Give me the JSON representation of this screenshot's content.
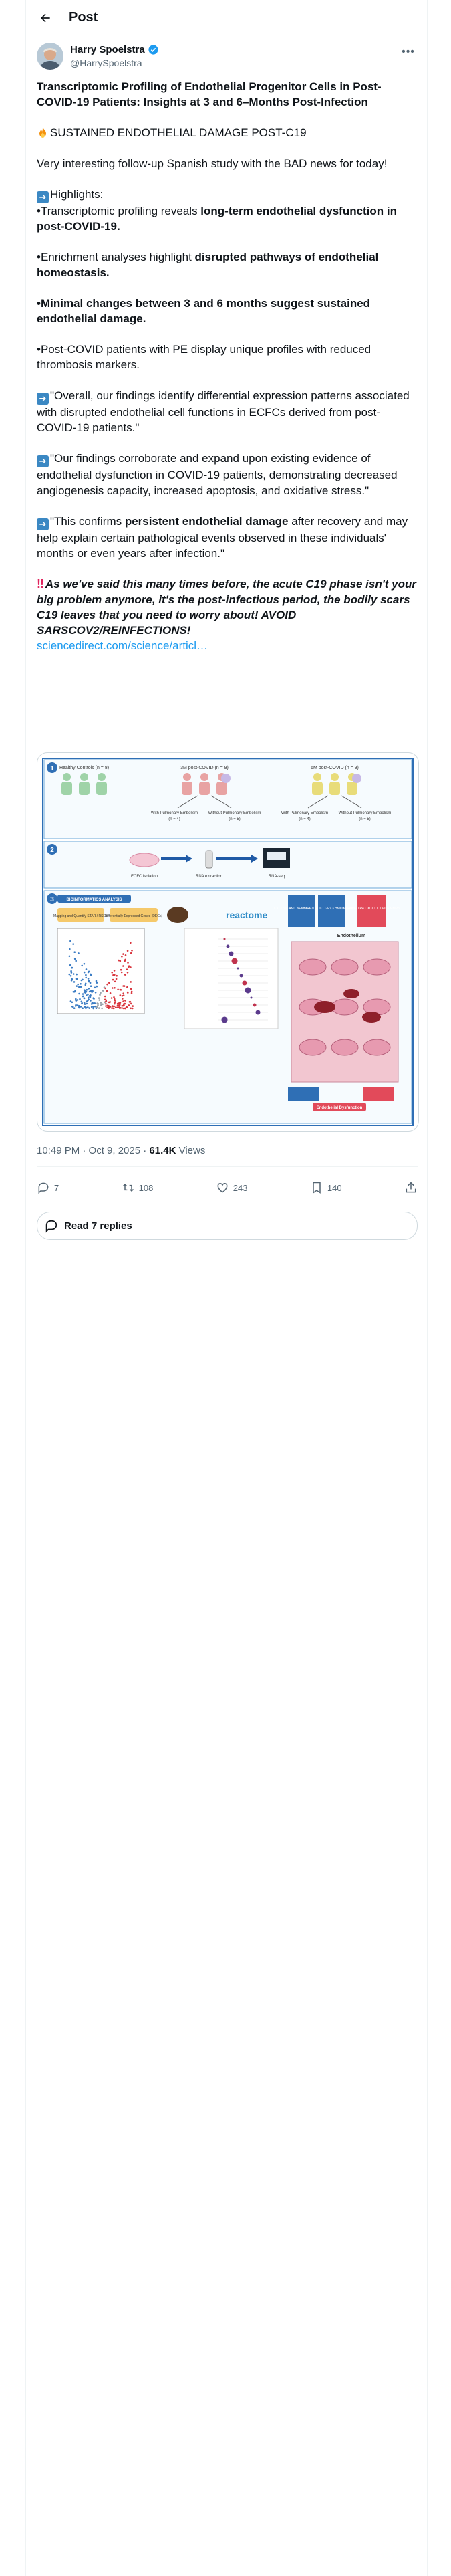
{
  "header": {
    "title": "Post"
  },
  "author": {
    "name": "Harry Spoelstra",
    "handle": "@HarrySpoelstra"
  },
  "tweet": {
    "title": "Transcriptomic Profiling of Endothelial Progenitor Cells in Post-COVID-19 Patients: Insights at 3 and 6–Months Post-Infection",
    "tag": "SUSTAINED ENDOTHELIAL DAMAGE POST-C19",
    "intro": "Very interesting follow-up Spanish study with the BAD news for today!",
    "highlights_label": "Highlights:",
    "h1_pre": "•Transcriptomic profiling reveals ",
    "h1_bold": "long-term endothelial dysfunction in post-COVID-19.",
    "h2_pre": "•Enrichment analyses highlight ",
    "h2_bold": "disrupted pathways of endothelial homeostasis.",
    "h3_bold": "•Minimal changes between 3 and 6 months suggest sustained endothelial damage.",
    "h4": "•Post-COVID patients with PE display unique profiles with reduced thrombosis markers.",
    "quote1": "\"Overall, our findings identify differential expression patterns associated with disrupted endothelial cell functions in ECFCs derived from post-COVID-19 patients.\"",
    "quote2": "\"Our findings corroborate and expand upon existing evidence of endothelial dysfunction in COVID-19 patients, demonstrating decreased angiogenesis capacity, increased apoptosis, and oxidative stress.\"",
    "confirm_pre": "\"This confirms ",
    "confirm_bold": "persistent endothelial damage",
    "confirm_post": " after recovery and may help explain certain pathological events observed in these individuals' months or even years after infection.\"",
    "warning": "As we've said this many times before, the acute C19 phase isn't your big problem anymore, it's the post-infectious period, the bodily scars C19 leaves that you need to worry about! AVOID SARSCOV2/REINFECTIONS!",
    "link": "sciencedirect.com/science/articl…"
  },
  "figure": {
    "panel_numbers": [
      "1",
      "2",
      "3"
    ],
    "groups": [
      {
        "title": "Healthy Controls (n = 8)",
        "color": "#9fd3a8"
      },
      {
        "title": "3M post-COVID (n = 9)",
        "color": "#e8a3a3"
      },
      {
        "title": "6M post-COVID (n = 9)",
        "color": "#e8dc7a"
      }
    ],
    "branch_labels": [
      "With Pulmonary Embolism",
      "Without Pulmonary Embolism"
    ],
    "branch_counts": [
      "(n = 4)",
      "(n = 5)"
    ],
    "step_labels": [
      "ECFC isolation",
      "RNA extraction",
      "RNA-seq"
    ],
    "bioinfo_label": "BIOINFORMATICS ANALYSIS",
    "box_labels": [
      "Mapping and Quantify STAR / RSEM",
      "Differentially Expressed Genes (DEGs)"
    ],
    "reactome": "reactome",
    "endo_label": "Endothelium",
    "dysfunction_label": "Endothelial Dysfunction",
    "gene_boxes": [
      "CXCL8 ICAM1 NFKB1 SOD2 TGFB1",
      "BIRC3 CLIC1 GPX3 HMOX1 PIK3R1",
      "VCAM1 TLR4 CXCL1 IL1A IL6 MMP3"
    ]
  },
  "meta": {
    "time": "10:49 PM · Oct 9, 2025 · ",
    "views_num": "61.4K",
    "views_label": " Views"
  },
  "actions": {
    "replies": "7",
    "reposts": "108",
    "likes": "243",
    "bookmarks": "140"
  },
  "read_replies": "Read 7 replies",
  "colors": {
    "link": "#1d9bf0",
    "text": "#0f1419",
    "muted": "#536471",
    "verified": "#1d9bf0"
  }
}
